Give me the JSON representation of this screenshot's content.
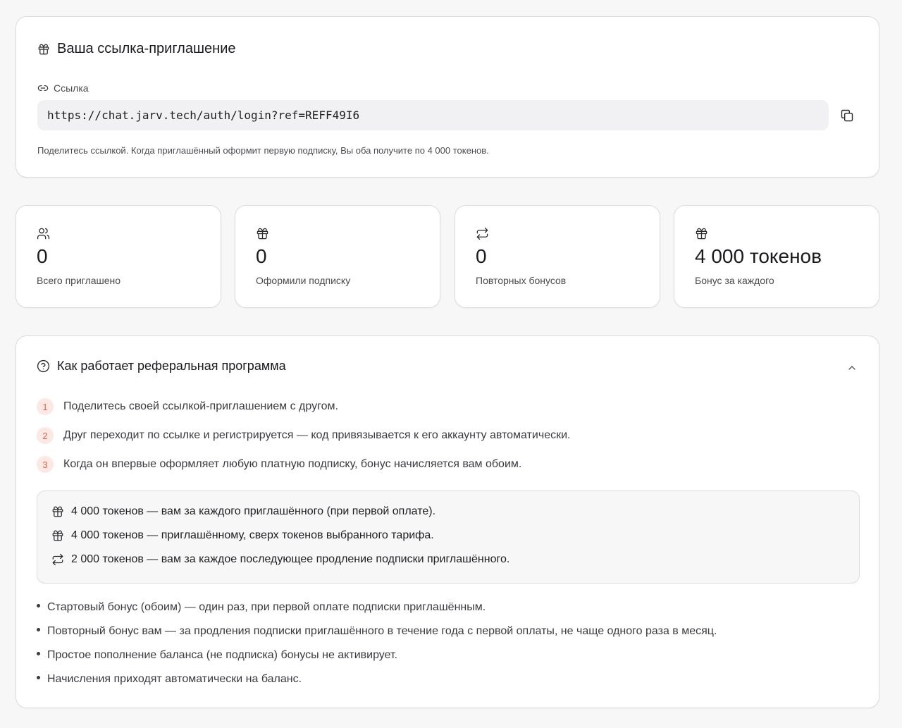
{
  "invite": {
    "title": "Ваша ссылка-приглашение",
    "title_icon": "gift-icon",
    "link_label": "Ссылка",
    "link_icon": "link-icon",
    "link_value": "https://chat.jarv.tech/auth/login?ref=REFF49I6",
    "copy_icon": "copy-icon",
    "description": "Поделитесь ссылкой. Когда приглашённый оформит первую подписку, Вы оба получите по 4 000 токенов."
  },
  "stats": [
    {
      "icon": "users-icon",
      "value": "0",
      "label": "Всего приглашено"
    },
    {
      "icon": "gift-icon",
      "value": "0",
      "label": "Оформили подписку"
    },
    {
      "icon": "repeat-icon",
      "value": "0",
      "label": "Повторных бонусов"
    },
    {
      "icon": "gift-icon",
      "value": "4 000 токенов",
      "label": "Бонус за каждого"
    }
  ],
  "how": {
    "title": "Как работает реферальная программа",
    "title_icon": "help-circle-icon",
    "collapse_icon": "chevron-up-icon",
    "steps": [
      {
        "number": "1",
        "text": "Поделитесь своей ссылкой-приглашением с другом."
      },
      {
        "number": "2",
        "text": "Друг переходит по ссылке и регистрируется — код привязывается к его аккаунту автоматически."
      },
      {
        "number": "3",
        "text": "Когда он впервые оформляет любую платную подписку, бонус начисляется вам обоим."
      }
    ],
    "bonuses": [
      {
        "icon": "gift-icon",
        "text": "4 000 токенов — вам за каждого приглашённого (при первой оплате)."
      },
      {
        "icon": "gift-icon",
        "text": "4 000 токенов — приглашённому, сверх токенов выбранного тарифа."
      },
      {
        "icon": "repeat-icon",
        "text": "2 000 токенов — вам за каждое последующее продление подписки приглашённого."
      }
    ],
    "notes": [
      "Стартовый бонус (обоим) — один раз, при первой оплате подписки приглашённым.",
      "Повторный бонус вам — за продления подписки приглашённого в течение года с первой оплаты, не чаще одного раза в месяц.",
      "Простое пополнение баланса (не подписка) бонусы не активирует.",
      "Начисления приходят автоматически на баланс."
    ]
  },
  "colors": {
    "accent_step_bg": "#fde9e4",
    "accent_step_text": "#e0664a",
    "page_bg": "#f7f7f8",
    "card_border": "#dcdce0"
  }
}
